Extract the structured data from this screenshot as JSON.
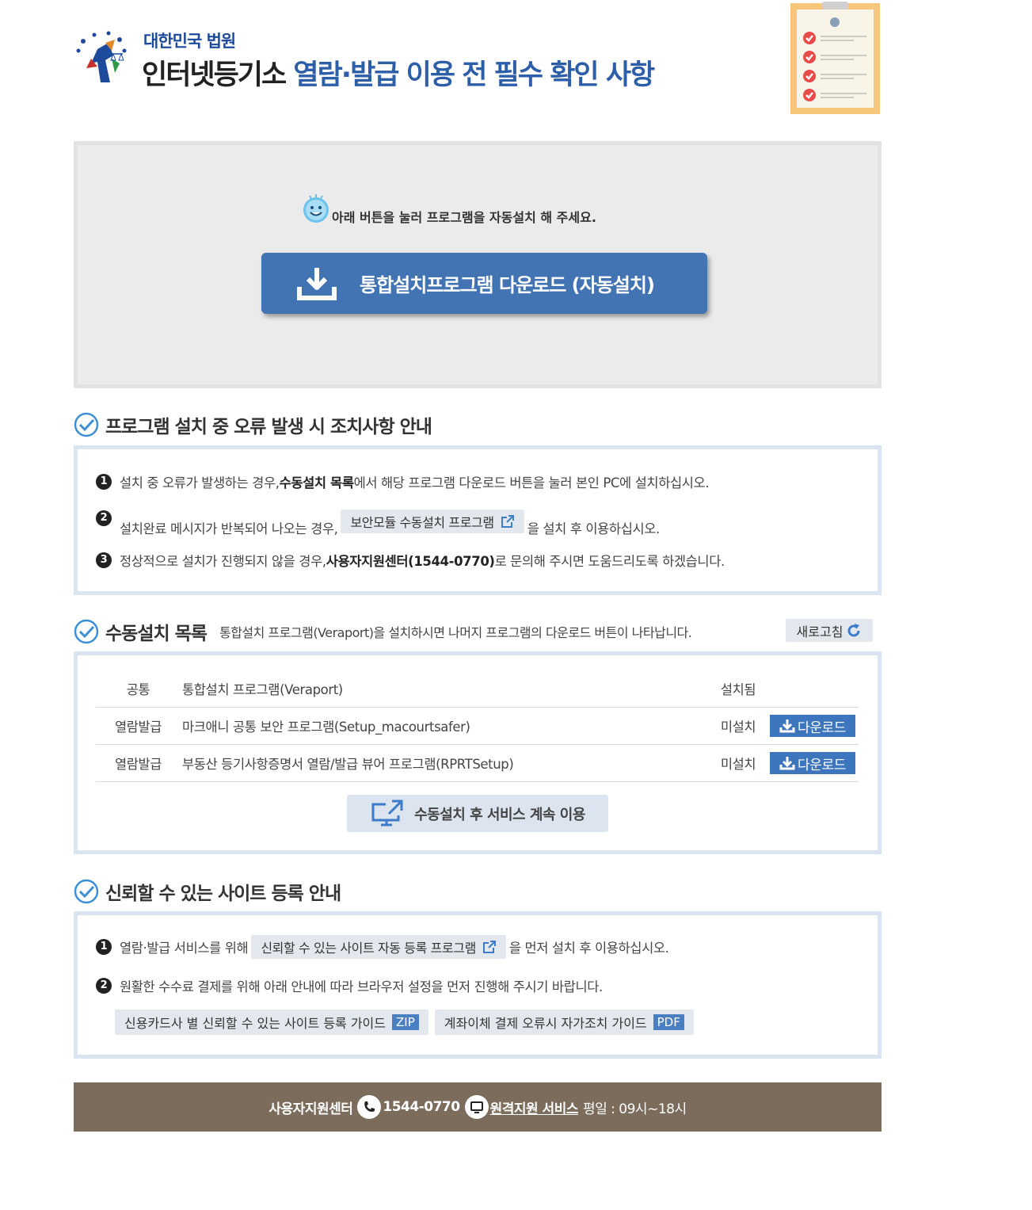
{
  "header": {
    "court_name": "대한민국 법원",
    "title_part1": "인터넷등기소 ",
    "title_part2": "열람·발급 이용 전 필수 확인 사항"
  },
  "install": {
    "message": "아래 버튼을 눌러 프로그램을 자동설치 해 주세요.",
    "button_label": "통합설치프로그램 다운로드 (자동설치)"
  },
  "error_section": {
    "title": "프로그램 설치 중 오류 발생 시 조치사항 안내",
    "item1": {
      "num": "1",
      "pre": "설치 중 오류가 발생하는 경우, ",
      "bold": "수동설치 목록",
      "post": "에서 해당 프로그램 다운로드 버튼을 눌러 본인 PC에 설치하십시오."
    },
    "item2": {
      "num": "2",
      "pre": "설치완료 메시지가 반복되어 나오는 경우, ",
      "button": "보안모듈 수동설치 프로그램",
      "post": "을 설치 후 이용하십시오."
    },
    "item3": {
      "num": "3",
      "pre": "정상적으로 설치가 진행되지 않을 경우, ",
      "bold": "사용자지원센터(1544-0770)",
      "post": "로 문의해 주시면 도움드리도록 하겠습니다."
    }
  },
  "manual_section": {
    "title": "수동설치 목록",
    "subtitle": "통합설치 프로그램(Veraport)을 설치하시면 나머지 프로그램의 다운로드 버튼이 나타납니다.",
    "refresh_label": "새로고침",
    "rows": [
      {
        "category": "공통",
        "program": "통합설치 프로그램(Veraport)",
        "status": "설치됨",
        "download": ""
      },
      {
        "category": "열람발급",
        "program": "마크애니 공통 보안 프로그램(Setup_macourtsafer)",
        "status": "미설치",
        "download": "다운로드"
      },
      {
        "category": "열람발급",
        "program": "부동산 등기사항증명서 열람/발급 뷰어 프로그램(RPRTSetup)",
        "status": "미설치",
        "download": "다운로드"
      }
    ],
    "continue_label": "수동설치 후 서비스 계속 이용"
  },
  "trust_section": {
    "title": "신뢰할 수 있는 사이트 등록 안내",
    "item1": {
      "num": "1",
      "pre": "열람·발급 서비스를 위해 ",
      "button": "신뢰할 수 있는 사이트 자동 등록 프로그램",
      "post": "을 먼저 설치 후 이용하십시오."
    },
    "item2": {
      "num": "2",
      "text": "원활한 수수료 결제를 위해 아래 안내에 따라 브라우저 설정을 먼저 진행해 주시기 바랍니다."
    },
    "guide1": {
      "label": "신용카드사 별 신뢰할 수 있는 사이트 등록 가이드",
      "tag": "ZIP"
    },
    "guide2": {
      "label": "계좌이체 결제 오류시 자가조치 가이드",
      "tag": "PDF"
    }
  },
  "footer": {
    "center": "사용자지원센터",
    "phone": "1544-0770",
    "remote": "원격지원 서비스",
    "hours": "평일 : 09시~18시"
  },
  "colors": {
    "brand_blue": "#4273b3",
    "panel_border": "#dae5f1",
    "footer_bg": "#7b6c5c"
  }
}
